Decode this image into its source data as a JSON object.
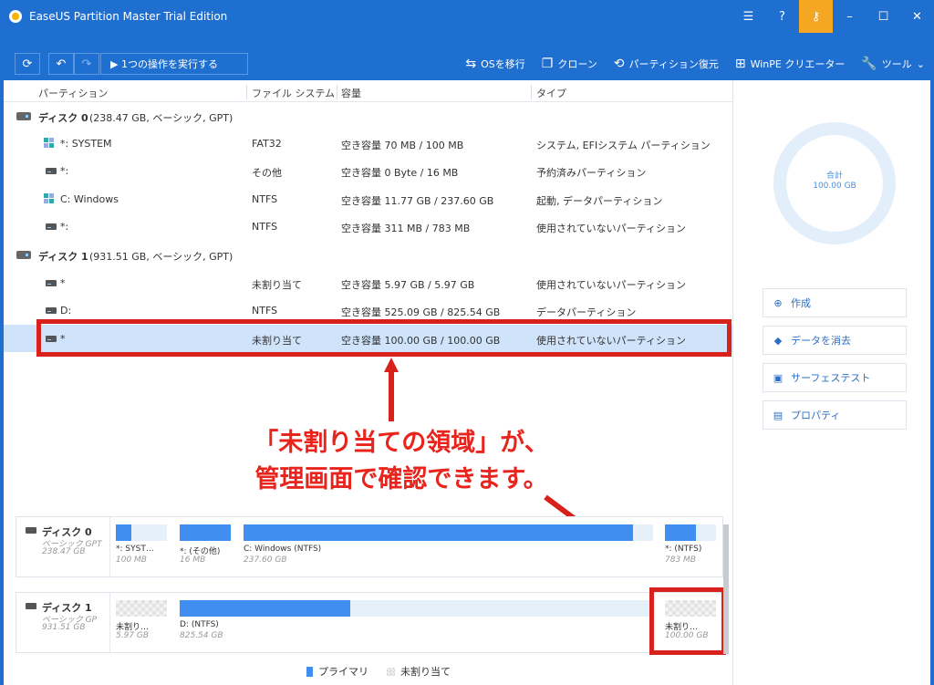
{
  "app": {
    "title": "EaseUS Partition Master Trial Edition"
  },
  "toolbar": {
    "exec_label": "▶ 1つの操作を実行する",
    "actions": [
      "OSを移行",
      "クローン",
      "パーティション復元",
      "WinPE クリエーター",
      "ツール"
    ]
  },
  "columns": [
    "パーティション",
    "ファイル システム",
    "容量",
    "タイプ"
  ],
  "disks": [
    {
      "name": "ディスク 0",
      "info": "(238.47 GB, ベーシック, GPT)"
    },
    {
      "name": "ディスク 1",
      "info": "(931.51 GB, ベーシック, GPT)"
    }
  ],
  "partitions": [
    {
      "name": "*: SYSTEM",
      "fs": "FAT32",
      "cap": "空き容量 70 MB / 100 MB",
      "type": "システム, EFIシステム パーティション"
    },
    {
      "name": "*:",
      "fs": "その他",
      "cap": "空き容量 0 Byte / 16 MB",
      "type": "予約済みパーティション"
    },
    {
      "name": "C: Windows",
      "fs": "NTFS",
      "cap": "空き容量 11.77 GB / 237.60 GB",
      "type": "起動, データパーティション"
    },
    {
      "name": "*:",
      "fs": "NTFS",
      "cap": "空き容量 311 MB / 783 MB",
      "type": "使用されていないパーティション"
    },
    {
      "name": "*",
      "fs": "未割り当て",
      "cap": "空き容量 5.97 GB / 5.97 GB",
      "type": "使用されていないパーティション"
    },
    {
      "name": "D:",
      "fs": "NTFS",
      "cap": "空き容量 525.09 GB / 825.54 GB",
      "type": "データパーティション"
    },
    {
      "name": "*",
      "fs": "未割り当て",
      "cap": "空き容量 100.00 GB / 100.00 GB",
      "type": "使用されていないパーティション"
    }
  ],
  "callout": {
    "line1": "「未割り当ての領域」が、",
    "line2": "管理画面で確認できます。"
  },
  "summary": {
    "label": "合計",
    "value": "100.00 GB"
  },
  "side_actions": [
    "作成",
    "データを消去",
    "サーフェステスト",
    "プロパティ"
  ],
  "diskmap": [
    {
      "name": "ディスク 0",
      "type": "ベーシック GPT",
      "size": "238.47 GB",
      "segments": [
        {
          "label": "*: SYST…",
          "size": "100 MB",
          "used": 0.3
        },
        {
          "label": "*: (その他)",
          "size": "16 MB",
          "used": 1.0
        },
        {
          "label": "C: Windows (NTFS)",
          "size": "237.60 GB",
          "used": 0.95
        },
        {
          "label": "*: (NTFS)",
          "size": "783 MB",
          "used": 0.6
        }
      ]
    },
    {
      "name": "ディスク 1",
      "type": "ベーシック GP",
      "size": "931.51 GB",
      "segments": [
        {
          "label": "未割り…",
          "size": "5.97 GB",
          "used": 0
        },
        {
          "label": "D: (NTFS)",
          "size": "825.54 GB",
          "used": 0.36
        },
        {
          "label": "未割り…",
          "size": "100.00 GB",
          "used": 0
        }
      ]
    }
  ],
  "legend": {
    "primary": "プライマリ",
    "unallocated": "未割り当て"
  },
  "colors": {
    "brand_blue": "#1f6fd1",
    "accent_orange": "#f5a623",
    "highlight_red": "#d9211b",
    "bar_blue": "#3f8ef0"
  }
}
